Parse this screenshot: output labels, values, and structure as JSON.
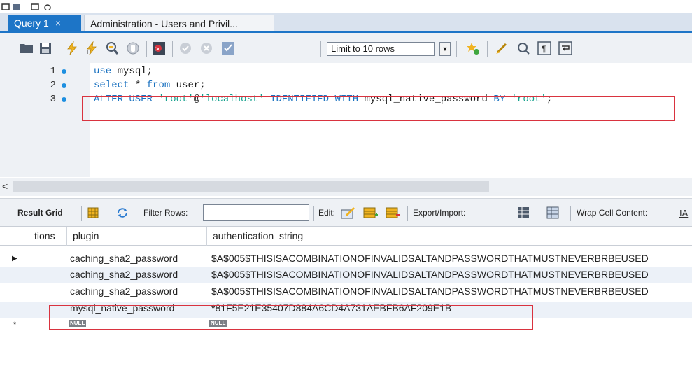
{
  "tabs": [
    {
      "label": "Query 1",
      "close": "×"
    },
    {
      "label": "Administration - Users and Privil..."
    }
  ],
  "toolbar": {
    "limit_label": "Limit to 10 rows",
    "icons": [
      "open-folder-icon",
      "save-icon",
      "execute-icon",
      "execute-current-icon",
      "explain-icon",
      "stop-icon",
      "toggle-error-icon",
      "commit-icon",
      "rollback-icon",
      "autocommit-icon",
      "bookmark-icon",
      "beautify-icon",
      "find-icon",
      "invisible-chars-icon",
      "wrap-icon"
    ]
  },
  "editor": {
    "lines": [
      {
        "num": "1",
        "parts": [
          {
            "t": "use",
            "c": "kw"
          },
          {
            "t": " mysql;",
            "c": "plain"
          }
        ]
      },
      {
        "num": "2",
        "parts": [
          {
            "t": "select",
            "c": "kw"
          },
          {
            "t": " * ",
            "c": "plain"
          },
          {
            "t": "from",
            "c": "kw"
          },
          {
            "t": " user;",
            "c": "plain"
          }
        ]
      },
      {
        "num": "3",
        "parts": [
          {
            "t": "ALTER USER ",
            "c": "kw"
          },
          {
            "t": "'root'",
            "c": "str"
          },
          {
            "t": "@",
            "c": "plain"
          },
          {
            "t": "'localhost'",
            "c": "str"
          },
          {
            "t": " IDENTIFIED WITH ",
            "c": "kw"
          },
          {
            "t": "mysql_native_password ",
            "c": "plain"
          },
          {
            "t": "BY ",
            "c": "kw"
          },
          {
            "t": "'root'",
            "c": "str"
          },
          {
            "t": ";",
            "c": "plain"
          }
        ]
      }
    ]
  },
  "scroll": {
    "left_arrow": "<"
  },
  "result_toolbar": {
    "result_grid": "Result Grid",
    "filter_rows": "Filter Rows:",
    "edit": "Edit:",
    "export_import": "Export/Import:",
    "wrap_cell": "Wrap Cell Content:"
  },
  "grid": {
    "columns": [
      "tions",
      "plugin",
      "authentication_string"
    ],
    "rows": [
      {
        "plugin": "caching_sha2_password",
        "auth": "$A$005$THISISACOMBINATIONOFINVALIDSALTANDPASSWORDTHATMUSTNEVERBRBEUSED"
      },
      {
        "plugin": "caching_sha2_password",
        "auth": "$A$005$THISISACOMBINATIONOFINVALIDSALTANDPASSWORDTHATMUSTNEVERBRBEUSED"
      },
      {
        "plugin": "caching_sha2_password",
        "auth": "$A$005$THISISACOMBINATIONOFINVALIDSALTANDPASSWORDTHATMUSTNEVERBRBEUSED"
      },
      {
        "plugin": "mysql_native_password",
        "auth": "*81F5E21E35407D884A6CD4A731AEBFB6AF209E1B"
      }
    ],
    "null_label": "NULL",
    "current_row_marker": "▶",
    "new_row_marker": "*"
  }
}
